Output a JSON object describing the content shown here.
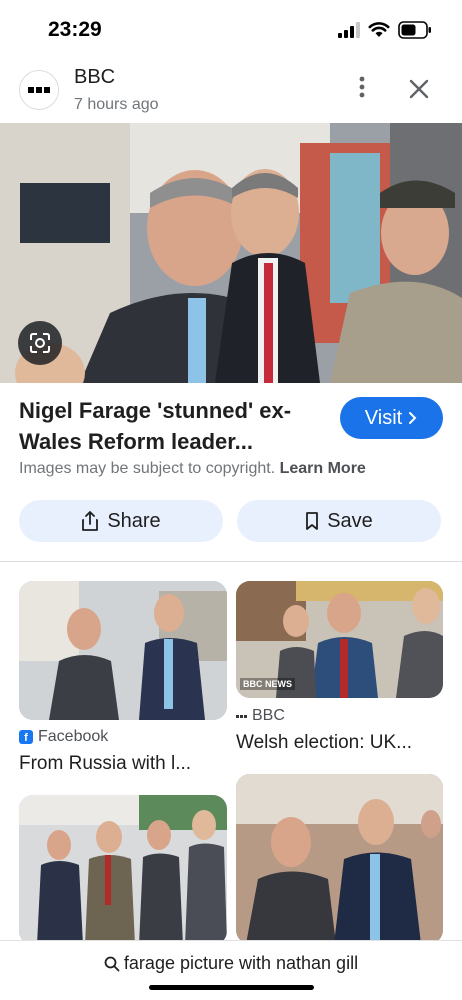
{
  "status_bar": {
    "time": "23:29"
  },
  "header": {
    "source": "BBC",
    "timestamp": "7 hours ago"
  },
  "result": {
    "title": "Nigel Farage 'stunned' ex-Wales Reform leader...",
    "visit_label": "Visit",
    "copyright_text": "Images may be subject to copyright.",
    "learn_more": "Learn More",
    "share_label": "Share",
    "save_label": "Save"
  },
  "related": [
    {
      "source": "Facebook",
      "title": "From Russia with l..."
    },
    {
      "source": "BBC",
      "title": "Welsh election: UK...",
      "image_tag": "BBC NEWS"
    }
  ],
  "search": {
    "query": "farage picture with nathan gill"
  },
  "colors": {
    "accent": "#1a73e8",
    "chip_bg": "#e8f0fe",
    "muted": "#70757a"
  },
  "icons": [
    "signal-icon",
    "wifi-icon",
    "battery-icon",
    "more-vert-icon",
    "close-icon",
    "lens-icon",
    "share-icon",
    "bookmark-icon",
    "chevron-right-icon",
    "facebook-icon",
    "search-icon"
  ]
}
